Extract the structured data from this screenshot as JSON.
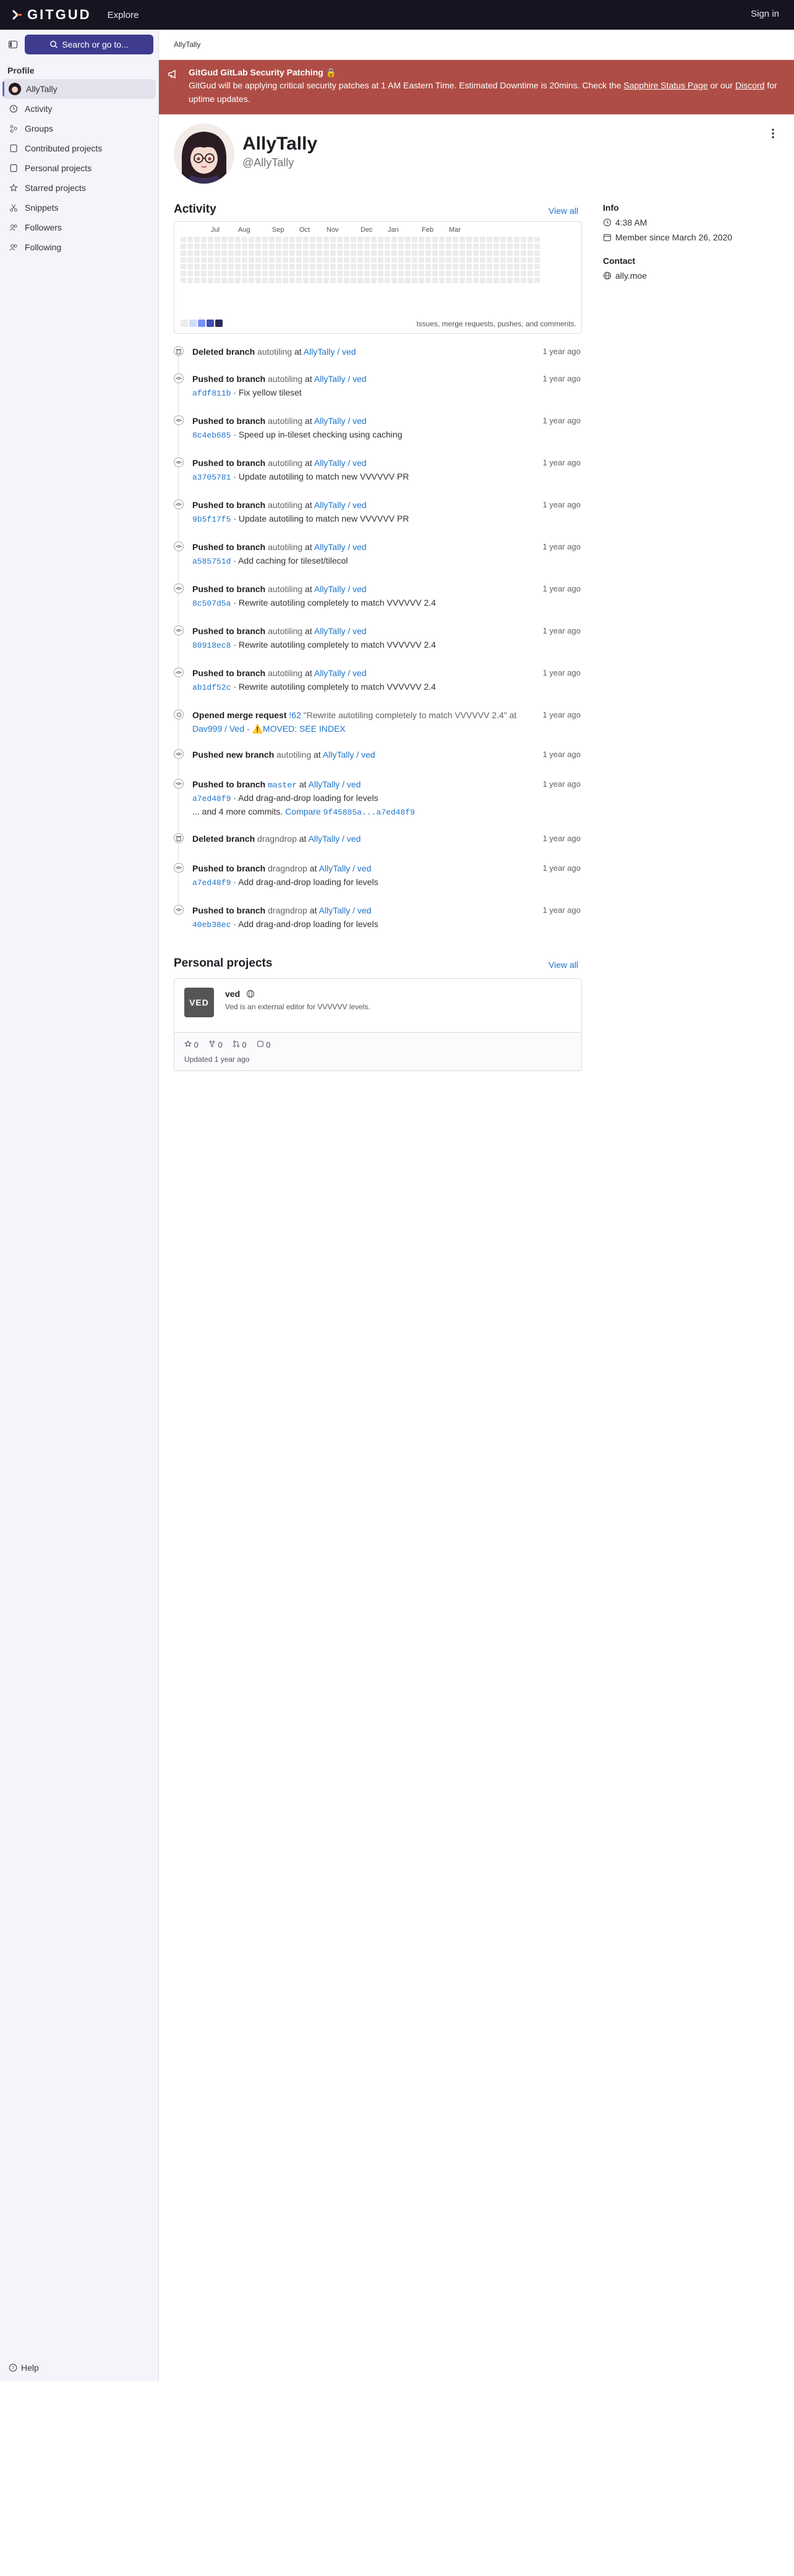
{
  "topbar": {
    "logo": "GITGUD",
    "explore": "Explore",
    "signin": "Sign in"
  },
  "sidebar": {
    "search": "Search or go to...",
    "section": "Profile",
    "items": [
      {
        "label": "AllyTally",
        "icon": "avatar"
      },
      {
        "label": "Activity",
        "icon": "history-icon"
      },
      {
        "label": "Groups",
        "icon": "group-icon"
      },
      {
        "label": "Contributed projects",
        "icon": "project-icon"
      },
      {
        "label": "Personal projects",
        "icon": "project-icon"
      },
      {
        "label": "Starred projects",
        "icon": "star-icon"
      },
      {
        "label": "Snippets",
        "icon": "snippet-icon"
      },
      {
        "label": "Followers",
        "icon": "users-icon"
      },
      {
        "label": "Following",
        "icon": "users-icon"
      }
    ],
    "help": "Help"
  },
  "breadcrumb": "AllyTally",
  "banner": {
    "title": "GitGud GitLab Security Patching 🔒",
    "body_1": "GitGud will be applying critical security patches at 1 AM Eastern Time. Estimated Downtime is 20mins. Check the ",
    "link_1": "Sapphire Status Page",
    "body_2": " or our ",
    "link_2": "Discord",
    "body_3": " for uptime updates.",
    "color": "#ae4d46"
  },
  "profile": {
    "name": "AllyTally",
    "handle": "@AllyTally"
  },
  "activity": {
    "title": "Activity",
    "view_all": "View all",
    "months": [
      "Jul",
      "Aug",
      "Sep",
      "Oct",
      "Nov",
      "Dec",
      "Jan",
      "Feb",
      "Mar"
    ],
    "legend_note": "Issues, merge requests, pushes, and comments."
  },
  "info": {
    "title": "Info",
    "time": "4:38 AM",
    "member_since": "Member since March 26, 2020",
    "contact_title": "Contact",
    "website": "ally.moe"
  },
  "events": [
    {
      "kind": "delete",
      "action": "Deleted branch",
      "branch": "autotiling",
      "at": "at",
      "project": "AllyTally / ved",
      "time": "1 year ago"
    },
    {
      "kind": "push",
      "action": "Pushed to branch",
      "branch": "autotiling",
      "at": "at",
      "project": "AllyTally / ved",
      "time": "1 year ago",
      "sha": "afdf811b",
      "msg": "· Fix yellow tileset"
    },
    {
      "kind": "push",
      "action": "Pushed to branch",
      "branch": "autotiling",
      "at": "at",
      "project": "AllyTally / ved",
      "time": "1 year ago",
      "sha": "8c4eb685",
      "msg": "· Speed up in-tileset checking using caching"
    },
    {
      "kind": "push",
      "action": "Pushed to branch",
      "branch": "autotiling",
      "at": "at",
      "project": "AllyTally / ved",
      "time": "1 year ago",
      "sha": "a3705781",
      "msg": "· Update autotiling to match new VVVVVV PR"
    },
    {
      "kind": "push",
      "action": "Pushed to branch",
      "branch": "autotiling",
      "at": "at",
      "project": "AllyTally / ved",
      "time": "1 year ago",
      "sha": "9b5f17f5",
      "msg": "· Update autotiling to match new VVVVVV PR"
    },
    {
      "kind": "push",
      "action": "Pushed to branch",
      "branch": "autotiling",
      "at": "at",
      "project": "AllyTally / ved",
      "time": "1 year ago",
      "sha": "a585751d",
      "msg": "· Add caching for tileset/tilecol"
    },
    {
      "kind": "push",
      "action": "Pushed to branch",
      "branch": "autotiling",
      "at": "at",
      "project": "AllyTally / ved",
      "time": "1 year ago",
      "sha": "8c507d5a",
      "msg": "· Rewrite autotiling completely to match VVVVVV 2.4"
    },
    {
      "kind": "push",
      "action": "Pushed to branch",
      "branch": "autotiling",
      "at": "at",
      "project": "AllyTally / ved",
      "time": "1 year ago",
      "sha": "80918ec8",
      "msg": "· Rewrite autotiling completely to match VVVVVV 2.4"
    },
    {
      "kind": "push",
      "action": "Pushed to branch",
      "branch": "autotiling",
      "at": "at",
      "project": "AllyTally / ved",
      "time": "1 year ago",
      "sha": "ab1df52c",
      "msg": "· Rewrite autotiling completely to match VVVVVV 2.4"
    },
    {
      "kind": "mr",
      "action": "Opened merge request",
      "mr": "!62",
      "mr_title": "\"Rewrite autotiling completely to match VVVVVV 2.4\" at",
      "project": "Dav999 / Ved - ⚠️MOVED: SEE INDEX",
      "time": "1 year ago"
    },
    {
      "kind": "push",
      "action": "Pushed new branch",
      "branch": "autotiling",
      "at": "at",
      "project": "AllyTally / ved",
      "time": "1 year ago"
    },
    {
      "kind": "push",
      "action": "Pushed to branch",
      "branch": "master",
      "at": "at",
      "project": "AllyTally / ved",
      "time": "1 year ago",
      "sha": "a7ed48f9",
      "msg": "· Add drag-and-drop loading for levels",
      "more": "... and 4 more commits.",
      "compare_label": "Compare",
      "compare": "9f45885a...a7ed48f9"
    },
    {
      "kind": "delete",
      "action": "Deleted branch",
      "branch": "dragndrop",
      "at": "at",
      "project": "AllyTally / ved",
      "time": "1 year ago"
    },
    {
      "kind": "push",
      "action": "Pushed to branch",
      "branch": "dragndrop",
      "at": "at",
      "project": "AllyTally / ved",
      "time": "1 year ago",
      "sha": "a7ed48f9",
      "msg": "· Add drag-and-drop loading for levels"
    },
    {
      "kind": "push",
      "action": "Pushed to branch",
      "branch": "dragndrop",
      "at": "at",
      "project": "AllyTally / ved",
      "time": "1 year ago",
      "sha": "40eb38ec",
      "msg": "· Add drag-and-drop loading for levels"
    }
  ],
  "personal": {
    "title": "Personal projects",
    "view_all": "View all",
    "project": {
      "logo": "VED",
      "name": "ved",
      "desc": "Ved is an external editor for VVVVVV levels.",
      "stars": "0",
      "forks": "0",
      "mrs": "0",
      "issues": "0",
      "updated": "Updated 1 year ago"
    }
  }
}
